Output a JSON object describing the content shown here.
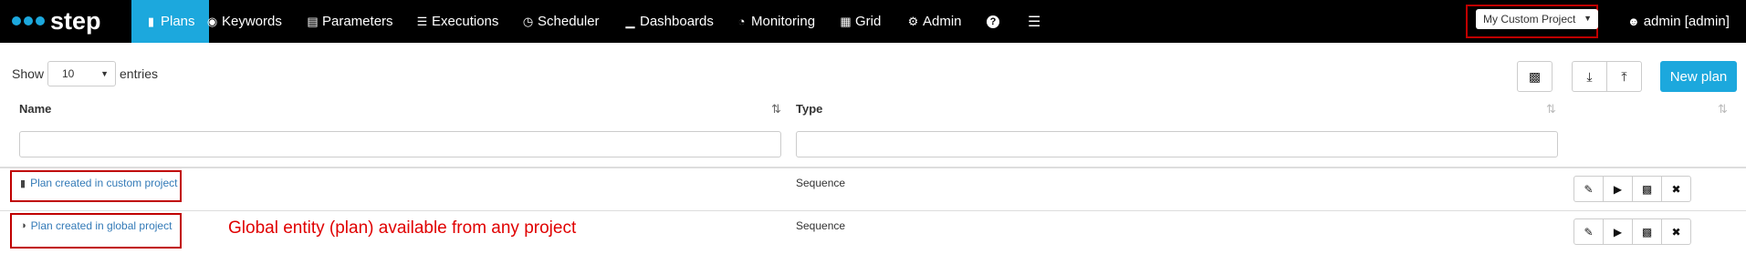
{
  "brand": {
    "name": "step",
    "color": "#1ca8dd"
  },
  "nav": {
    "items": [
      {
        "label": "Plans",
        "icon": "file-icon",
        "active": true
      },
      {
        "label": "Keywords",
        "icon": "target-icon"
      },
      {
        "label": "Parameters",
        "icon": "list-icon"
      },
      {
        "label": "Executions",
        "icon": "tasks-icon"
      },
      {
        "label": "Scheduler",
        "icon": "clock-icon"
      },
      {
        "label": "Dashboards",
        "icon": "bar-chart-icon"
      },
      {
        "label": "Monitoring",
        "icon": "dashboard-icon"
      },
      {
        "label": "Grid",
        "icon": "grid-icon"
      },
      {
        "label": "Admin",
        "icon": "gear-icon"
      }
    ],
    "help_icon": "question-icon",
    "menu_icon": "hamburger-icon",
    "project": "My Custom Project",
    "user": "admin [admin]"
  },
  "controls": {
    "show_label": "Show",
    "page_length": "10",
    "entries_label": "entries",
    "new_plan_label": "New plan"
  },
  "table": {
    "columns": [
      "Name",
      "Type"
    ],
    "rows": [
      {
        "name": "Plan created in custom project",
        "type": "Sequence",
        "icon": "file-icon"
      },
      {
        "name": "Plan created in global project",
        "type": "Sequence",
        "icon": "globe-icon"
      }
    ],
    "row_actions": [
      "edit-icon",
      "play-icon",
      "clone-icon",
      "delete-icon"
    ]
  },
  "annotation": "Global entity (plan) available from any project",
  "colors": {
    "accent": "#1ca8dd",
    "highlight": "#c00000",
    "annotation": "#e00000"
  }
}
